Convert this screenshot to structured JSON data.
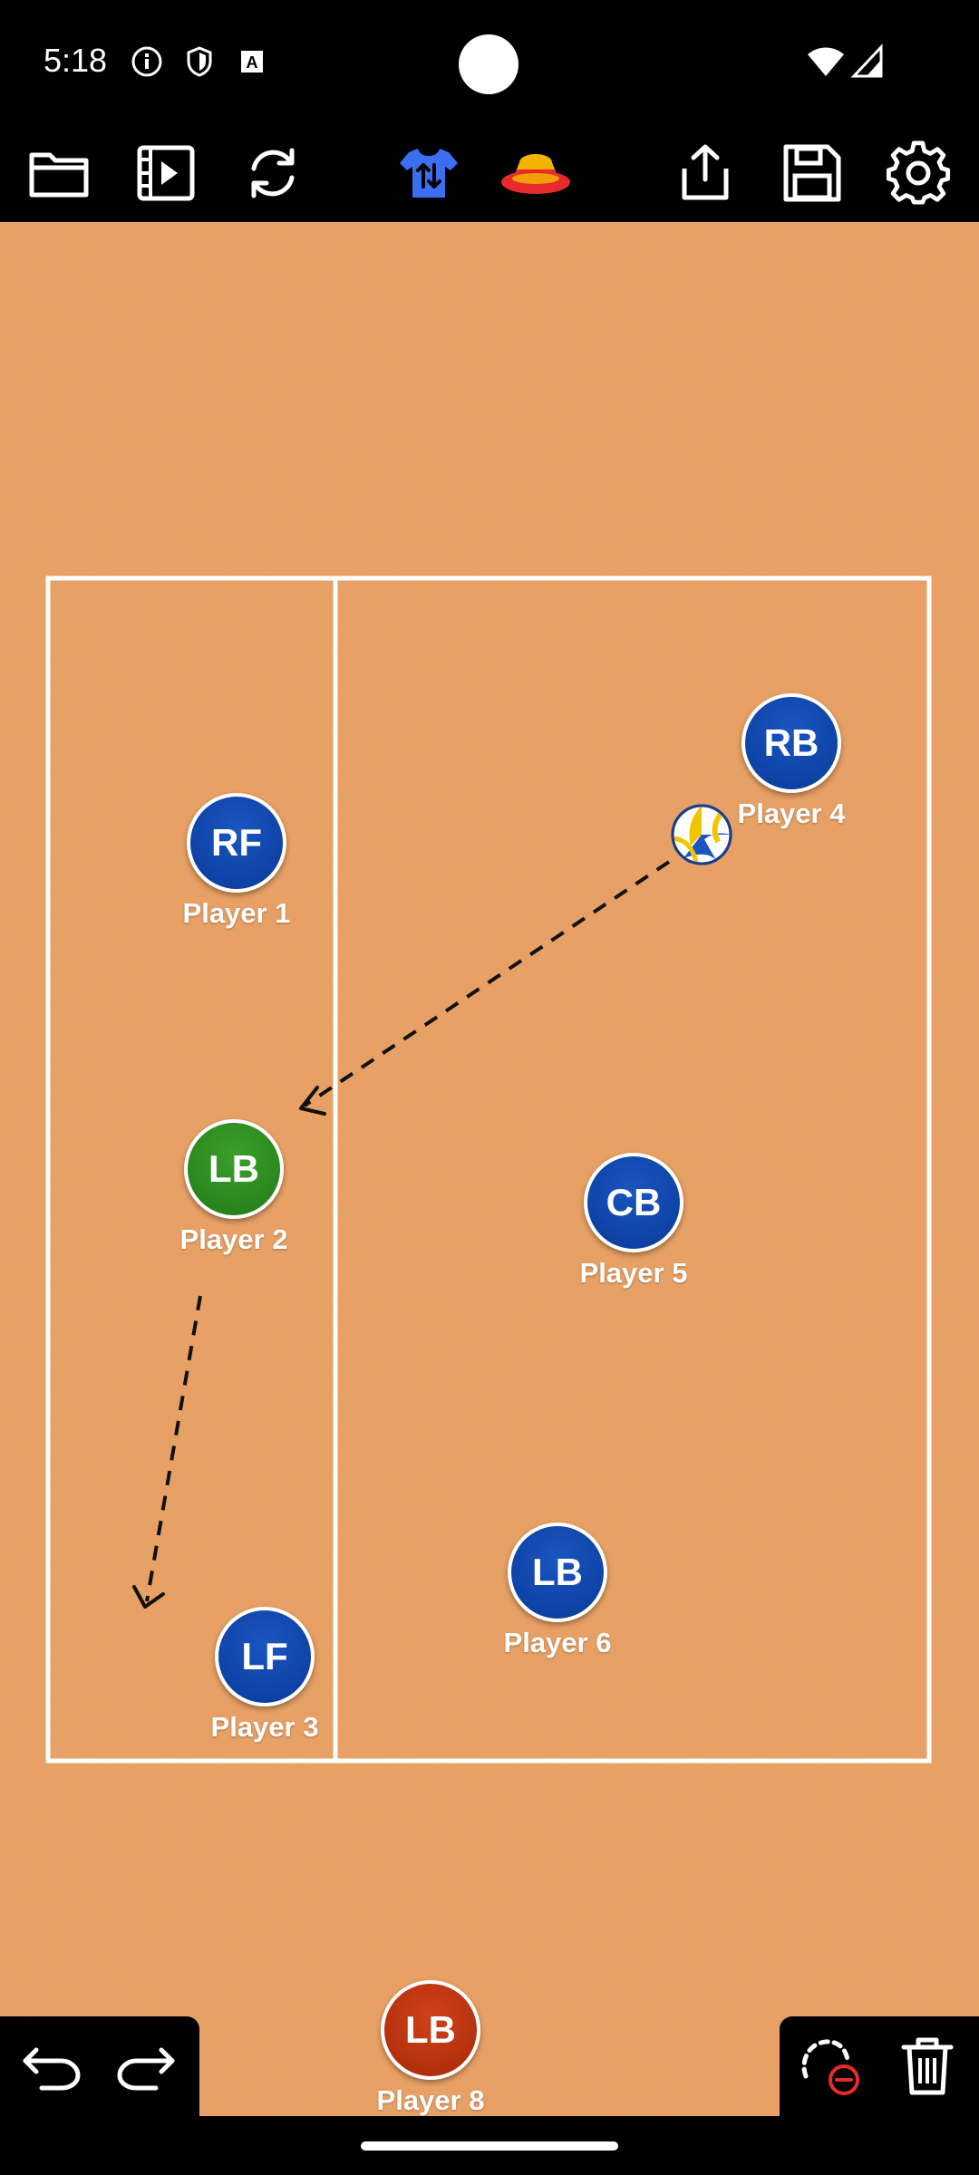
{
  "status_bar": {
    "time": "5:18",
    "icons": [
      "info-icon",
      "shield-icon",
      "font-icon",
      "wifi-icon",
      "signal-icon"
    ]
  },
  "toolbar": {
    "items": [
      "folder-icon",
      "video-icon",
      "refresh-icon",
      "jersey-swap-icon",
      "cones-icon",
      "share-icon",
      "save-icon",
      "settings-icon"
    ],
    "accent_blue": "#3b6ef0",
    "cone_colors": [
      "#e82a2a",
      "#f2b400"
    ]
  },
  "court": {
    "background": "#E8A064",
    "line_color": "#ffffff"
  },
  "players": [
    {
      "badge": "RF",
      "name": "Player 1",
      "color": "blue"
    },
    {
      "badge": "LB",
      "name": "Player 2",
      "color": "green"
    },
    {
      "badge": "LF",
      "name": "Player 3",
      "color": "blue"
    },
    {
      "badge": "RB",
      "name": "Player 4",
      "color": "blue"
    },
    {
      "badge": "CB",
      "name": "Player 5",
      "color": "blue"
    },
    {
      "badge": "LB",
      "name": "Player 6",
      "color": "blue"
    },
    {
      "badge": "LB",
      "name": "Player 8",
      "color": "red"
    }
  ],
  "bottom_controls": {
    "left": [
      "undo-icon",
      "redo-icon"
    ],
    "right": [
      "delete-path-icon",
      "trash-icon"
    ]
  }
}
